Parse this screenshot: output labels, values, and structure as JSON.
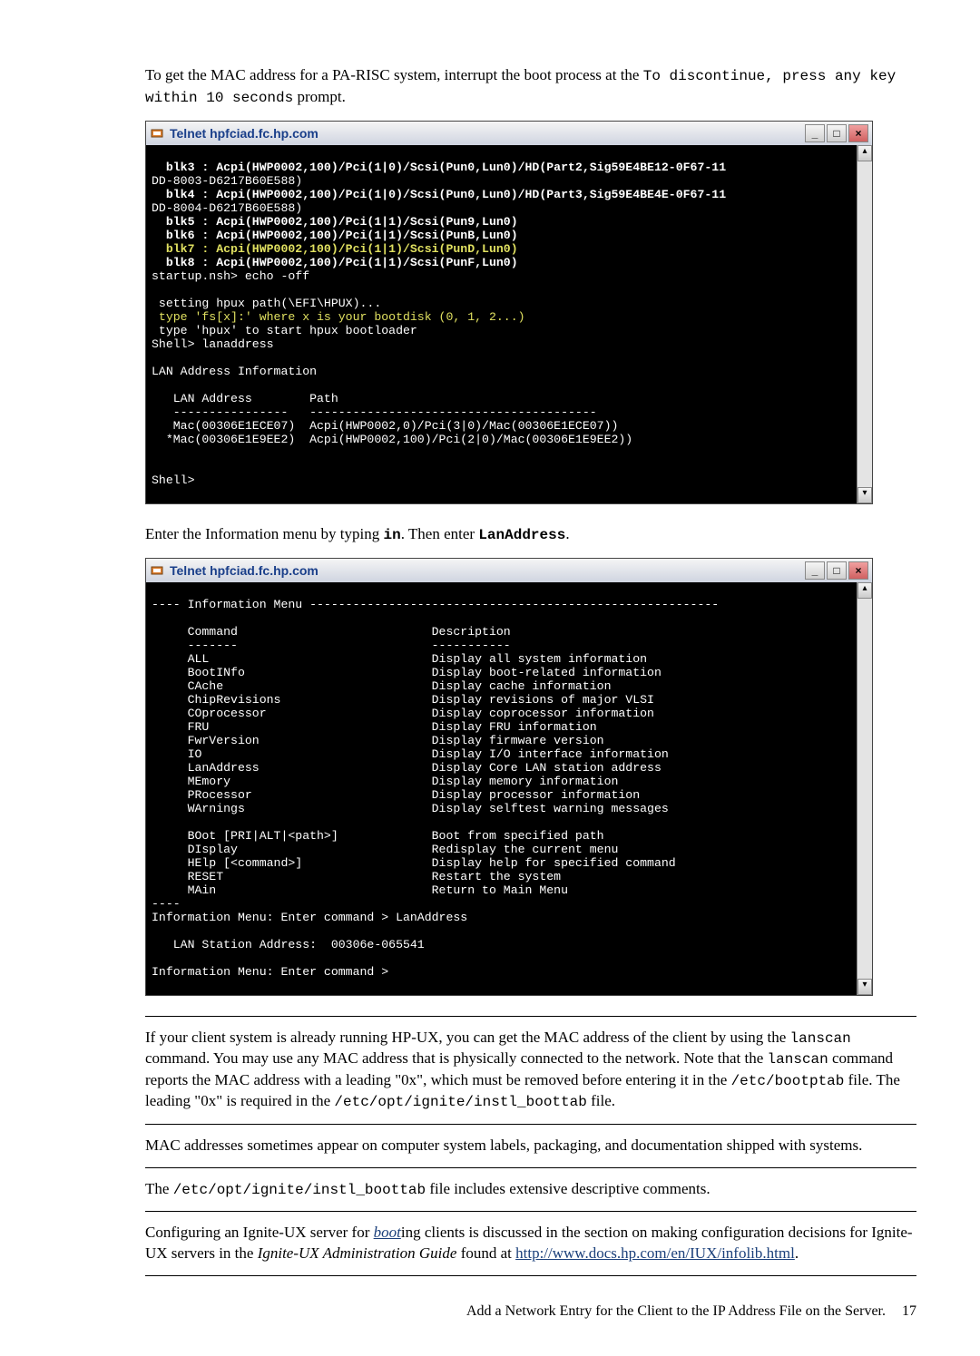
{
  "intro": {
    "p1a": "To get the MAC address for a PA-RISC system, interrupt the boot process at the ",
    "p1_code": "To discontinue, press any key within 10 seconds",
    "p1b": " prompt."
  },
  "telnet1": {
    "title": "Telnet hpfciad.fc.hp.com",
    "btn_min": "_",
    "btn_max": "□",
    "btn_close": "×",
    "content": "  blk3 : Acpi(HWP0002,100)/Pci(1|0)/Scsi(Pun0,Lun0)/HD(Part2,Sig59E4BE12-0F67-11\nDD-8003-D6217B60E588)\n  blk4 : Acpi(HWP0002,100)/Pci(1|0)/Scsi(Pun0,Lun0)/HD(Part3,Sig59E4BE4E-0F67-11\nDD-8004-D6217B60E588)\n  blk5 : Acpi(HWP0002,100)/Pci(1|1)/Scsi(Pun9,Lun0)\n  blk6 : Acpi(HWP0002,100)/Pci(1|1)/Scsi(PunB,Lun0)\n  blk7 : Acpi(HWP0002,100)/Pci(1|1)/Scsi(PunD,Lun0)\n  blk8 : Acpi(HWP0002,100)/Pci(1|1)/Scsi(PunF,Lun0)\nstartup.nsh> echo -off\n\n setting hpux path(\\EFI\\HPUX)...\n type 'fs[x]:' where x is your bootdisk (0, 1, 2...)\n type 'hpux' to start hpux bootloader\nShell> lanaddress\n\nLAN Address Information\n\n   LAN Address        Path\n   ----------------   ----------------------------------------\n   Mac(00306E1ECE07)  Acpi(HWP0002,0)/Pci(3|0)/Mac(00306E1ECE07))\n  *Mac(00306E1E9EE2)  Acpi(HWP0002,100)/Pci(2|0)/Mac(00306E1E9EE2))\n\n\nShell>",
    "yellow_lines": [
      6,
      11,
      21
    ],
    "bold_lines": [
      0,
      2,
      4,
      5,
      6,
      7
    ]
  },
  "mid": {
    "p1a": "Enter the Information menu by typing ",
    "p1_code1": "in",
    "p1b": ". Then enter ",
    "p1_code2": "LanAddress",
    "p1c": "."
  },
  "telnet2": {
    "title": "Telnet hpfciad.fc.hp.com",
    "btn_min": "_",
    "btn_max": "□",
    "btn_close": "×",
    "content": "---- Information Menu ---------------------------------------------------------\n\n     Command                           Description\n     -------                           -----------\n     ALL                               Display all system information\n     BootINfo                          Display boot-related information\n     CAche                             Display cache information\n     ChipRevisions                     Display revisions of major VLSI\n     COprocessor                       Display coprocessor information\n     FRU                               Display FRU information\n     FwrVersion                        Display firmware version\n     IO                                Display I/O interface information\n     LanAddress                        Display Core LAN station address\n     MEmory                            Display memory information\n     PRocessor                         Display processor information\n     WArnings                          Display selftest warning messages\n\n     BOot [PRI|ALT|<path>]             Boot from specified path\n     DIsplay                           Redisplay the current menu\n     HElp [<command>]                  Display help for specified command\n     RESET                             Restart the system\n     MAin                              Return to Main Menu\n----\nInformation Menu: Enter command > LanAddress\n\n   LAN Station Address:  00306e-065541\n\nInformation Menu: Enter command >"
  },
  "after": {
    "p1a": "If your client system is already running HP-UX, you can get the MAC address of the client by using the ",
    "p1_c1": "lanscan",
    "p1b": " command. You may use any MAC address that is physically connected to the network. Note that the ",
    "p1_c2": "lanscan",
    "p1c": " command reports the MAC address with a leading \"0x\", which must be removed before entering it in the ",
    "p1_c3": "/etc/bootptab",
    "p1d": " file. The leading \"0x\" is required in the ",
    "p1_c4": "/etc/opt/ignite/instl_boottab",
    "p1e": " file.",
    "p2": "MAC addresses sometimes appear on computer system labels, packaging, and documentation shipped with systems.",
    "p3a": "The ",
    "p3_c1": "/etc/opt/ignite/instl_boottab",
    "p3b": " file includes extensive descriptive comments.",
    "p4a": "Configuring an Ignite-UX server for ",
    "p4_link1": "boot",
    "p4b": "ing clients is discussed in the section on making configuration decisions for Ignite-UX servers in the ",
    "p4_i": "Ignite-UX Administration Guide",
    "p4c": " found at ",
    "p4_link2": "http://www.docs.hp.com/en/IUX/infolib.html",
    "p4d": "."
  },
  "footer": {
    "label": "Add a Network Entry for the Client to the IP Address File on the Server.",
    "page": "17"
  }
}
